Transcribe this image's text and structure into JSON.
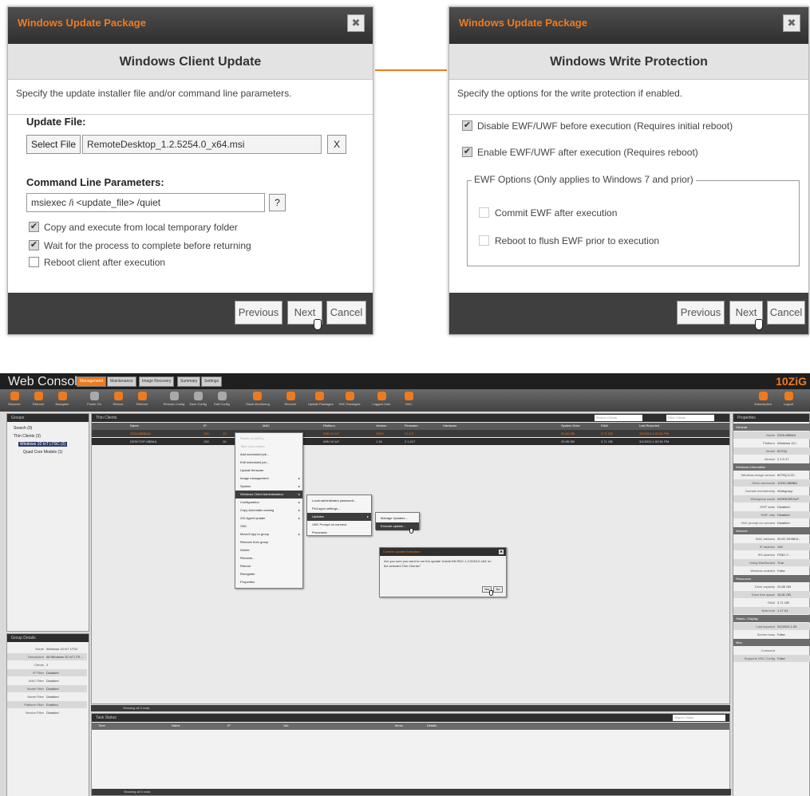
{
  "left_dialog": {
    "window_title": "Windows Update Package",
    "close_glyph": "✖",
    "heading": "Windows Client Update",
    "description": "Specify the update installer file and/or command line parameters.",
    "update_file_label": "Update File:",
    "select_file_button": "Select File",
    "update_file_value": "RemoteDesktop_1.2.5254.0_x64.msi",
    "clear_button": "X",
    "cmd_params_label": "Command Line Parameters:",
    "cmd_params_value": "msiexec /i <update_file> /quiet",
    "help_button": "?",
    "checkboxes": [
      {
        "label": "Copy and execute from local temporary folder",
        "checked": true
      },
      {
        "label": "Wait for the process to complete before returning",
        "checked": true
      },
      {
        "label": "Reboot client after execution",
        "checked": false
      }
    ],
    "buttons": {
      "previous": "Previous",
      "next": "Next",
      "cancel": "Cancel"
    }
  },
  "right_dialog": {
    "window_title": "Windows Update Package",
    "close_glyph": "✖",
    "heading": "Windows Write Protection",
    "description": "Specify the options for the write protection if enabled.",
    "checkboxes": [
      {
        "label": "Disable EWF/UWF before execution (Requires initial reboot)",
        "checked": true
      },
      {
        "label": "Enable EWF/UWF after execution (Requires reboot)",
        "checked": true
      }
    ],
    "ewf_group_label": "EWF Options (Only applies to Windows 7 and prior)",
    "ewf_options": [
      {
        "label": "Commit EWF after execution",
        "checked": false
      },
      {
        "label": "Reboot to flush EWF prior to execution",
        "checked": false
      }
    ],
    "buttons": {
      "previous": "Previous",
      "next": "Next",
      "cancel": "Cancel"
    }
  },
  "console": {
    "logo": "Web Console",
    "brand": "10ZiG",
    "tabs": [
      "Management",
      "Maintenance",
      "Image Recovery",
      "Summary",
      "Settings"
    ],
    "toolbar": [
      "Discover",
      "Refresh",
      "Navigator",
      "Power On",
      "Reboot",
      "Refresh",
      "Remote Config",
      "Save Config",
      "Edit Config",
      "Stock Monitoring",
      "Recover",
      "Update Packages",
      "VNC Packages",
      "Logged User",
      "VNC"
    ],
    "toolbar_right": [
      "Subscription",
      "Logout"
    ],
    "groups_title": "Groups",
    "tree": [
      "Search (0)",
      "Thin Clients (3)",
      "Windows 10 IoT LTSC (2)",
      "Quad Core Models (1)"
    ],
    "clients_title": "Thin Clients",
    "search_placeholder": "Search Clients",
    "filter_placeholder": "Filter Clients",
    "columns": [
      "Name",
      "IP",
      "MAC",
      "Platform",
      "Version",
      "Firmware",
      "Hardware",
      "System Drive",
      "RAM",
      "Last Reported"
    ],
    "rows": [
      [
        "ZIG5-6BBBAA",
        "192.",
        "10",
        "",
        "WIN 10 IoT",
        "23H2",
        "21.0.0",
        "29.85 GB",
        "3.71 GB",
        "3/1/2024 1:53:51 PM"
      ],
      [
        "DESKTOP-6BBAA",
        "192.",
        "10",
        "",
        "WIN 10 IoT",
        "1.16",
        "2.1.017",
        "29.85 GB",
        "3.71 GB",
        "3/1/2024 1:53:51 PM"
      ]
    ],
    "context_menu": [
      "Power on (WOL)",
      "Take over control",
      "Add scheduled job...",
      "Edit scheduled job...",
      "Update firmware",
      "Image management",
      "System",
      "Windows Client Administration",
      "Configuration",
      "Copy Automatic naming",
      "ZIG Agent update",
      "VNC",
      "Move/Copy to group",
      "Remove from group",
      "Delete",
      "Rename...",
      "Reboot",
      "Reregister",
      "Properties"
    ],
    "submenu_1": [
      "Local administrator password...",
      "Ps/Logon settings...",
      "Updates",
      "VNC Prompt on connect",
      "Processes"
    ],
    "submenu_2": [
      "Manage Updates...",
      "Execute update..."
    ],
    "confirm": {
      "title": "Confirm Update Execution",
      "message": "Are you sure you want to run the update 'Install-KB-RDC-1.2.5254.0-x64' on the selected Thin Clients?",
      "yes": "Yes",
      "no": "No"
    },
    "group_details_title": "Group Details",
    "group_details": [
      [
        "Name",
        "Windows 10 IoT LTSC"
      ],
      [
        "Description",
        "All Windows 10 IoT LTS..."
      ],
      [
        "Clients",
        "2"
      ],
      [
        "IP Filter",
        "Disabled"
      ],
      [
        "MAC Filter",
        "Disabled"
      ],
      [
        "Model Filter",
        "Disabled"
      ],
      [
        "Name Filter",
        "Disabled"
      ],
      [
        "Platform Filter",
        "Enabled"
      ],
      [
        "Version Filter",
        "Disabled"
      ]
    ],
    "properties_title": "Properties",
    "properties": [
      [
        "General",
        ""
      ],
      [
        "Name",
        "ZIG5-6BBAA"
      ],
      [
        "Platform",
        "Windows 10 I"
      ],
      [
        "Model",
        "6070Q"
      ],
      [
        "Version",
        "2.1.0.17"
      ],
      [
        "Windows Information",
        ""
      ],
      [
        "Windows image version",
        "6070Q-5.22..."
      ],
      [
        "Other username",
        "10ZIG-6B8BA"
      ],
      [
        "Domain membership",
        "Workgroup"
      ],
      [
        "Workgroup name",
        "WORKGROUP"
      ],
      [
        "EWF state",
        "Disabled"
      ],
      [
        "EWF only",
        "Disabled"
      ],
      [
        "VNC prompt on connect",
        "Disabled"
      ],
      [
        "Network",
        ""
      ],
      [
        "MAC address",
        "00:0C:29:B8:B..."
      ],
      [
        "IP address",
        "192."
      ],
      [
        "IP6 address",
        "FE80::7..."
      ],
      [
        "Using WanBooted",
        "True"
      ],
      [
        "Wireless enabled",
        "False"
      ],
      [
        "Resources",
        ""
      ],
      [
        "Drive capacity",
        "29.85 GB"
      ],
      [
        "Drive free space",
        "15.81 GB"
      ],
      [
        "RAM",
        "3.71 GB"
      ],
      [
        "Build info",
        "1.17.03"
      ],
      [
        "Status / Display",
        ""
      ],
      [
        "Last reported",
        "3/1/2024 1:53"
      ],
      [
        "Screen busy",
        "False"
      ],
      [
        "Misc",
        ""
      ],
      [
        "Comment",
        ""
      ],
      [
        "Supports VNC Config",
        "False"
      ]
    ],
    "status_top": "Showing all 2 rows",
    "tasks_title": "Task Status",
    "task_search": "Search Tasks",
    "task_columns": [
      "Time",
      "Name",
      "IP",
      "Job",
      "Items",
      "Details"
    ],
    "status_bottom": "Showing all 0 rows"
  },
  "colors": {
    "accent": "#ef7b1f",
    "titlebar": "#3a3a3a",
    "footer": "#3f3f3f"
  }
}
